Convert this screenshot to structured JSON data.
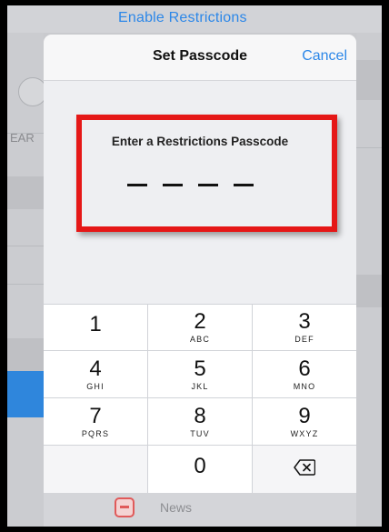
{
  "background": {
    "link_text": "Enable Restrictions",
    "partial_label": "EAR",
    "bottom_item_label": "News"
  },
  "dialog": {
    "title": "Set Passcode",
    "cancel_label": "Cancel",
    "prompt": "Enter a Restrictions Passcode",
    "digits_entered": 0,
    "digit_count": 4,
    "placeholder_glyph": "—"
  },
  "keypad": {
    "keys": [
      {
        "num": "1",
        "letters": ""
      },
      {
        "num": "2",
        "letters": "ABC"
      },
      {
        "num": "3",
        "letters": "DEF"
      },
      {
        "num": "4",
        "letters": "GHI"
      },
      {
        "num": "5",
        "letters": "JKL"
      },
      {
        "num": "6",
        "letters": "MNO"
      },
      {
        "num": "7",
        "letters": "PQRS"
      },
      {
        "num": "8",
        "letters": "TUV"
      },
      {
        "num": "9",
        "letters": "WXYZ"
      },
      {
        "num": "0",
        "letters": ""
      }
    ],
    "delete_icon": "backspace-icon"
  },
  "colors": {
    "accent": "#2c87e8",
    "highlight": "#e51717"
  }
}
